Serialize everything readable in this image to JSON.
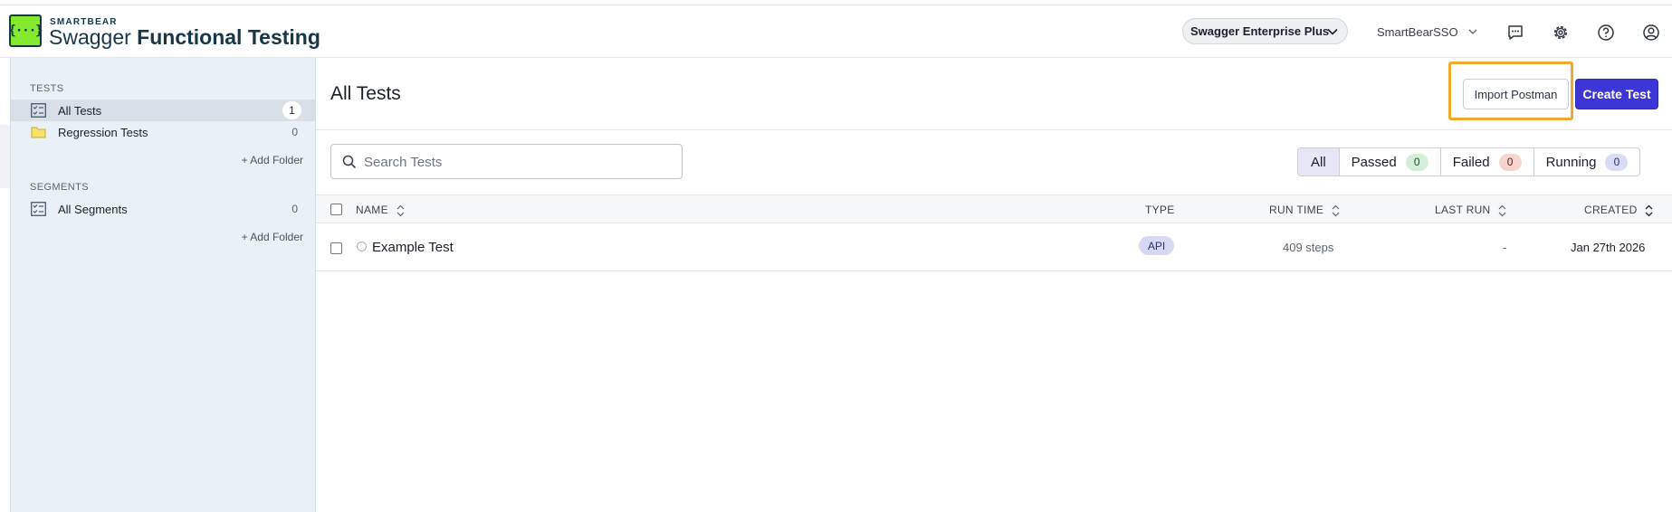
{
  "header": {
    "brand_small": "SMARTBEAR",
    "brand_first": "Swagger",
    "brand_rest": "Functional Testing",
    "logo_text": "{···}",
    "plan_label": "Swagger Enterprise Plus",
    "user_label": "SmartBearSSO"
  },
  "sidebar": {
    "tests_section": "TESTS",
    "tests_items": [
      {
        "label": "All Tests",
        "count": "1",
        "icon": "test-list-icon"
      },
      {
        "label": "Regression Tests",
        "count": "0",
        "icon": "folder-icon"
      }
    ],
    "add_folder_label": "+ Add Folder",
    "segments_section": "SEGMENTS",
    "segments_items": [
      {
        "label": "All Segments",
        "count": "0",
        "icon": "test-list-icon"
      }
    ]
  },
  "main": {
    "title": "All Tests",
    "import_label": "Import Postman",
    "create_label": "Create Test",
    "search_placeholder": "Search Tests",
    "filters": [
      {
        "label": "All"
      },
      {
        "label": "Passed",
        "count": "0"
      },
      {
        "label": "Failed",
        "count": "0"
      },
      {
        "label": "Running",
        "count": "0"
      }
    ],
    "columns": {
      "name": "NAME",
      "type": "TYPE",
      "run_time": "RUN TIME",
      "last_run": "LAST RUN",
      "created": "CREATED"
    },
    "rows": [
      {
        "name": "Example Test",
        "type": "API",
        "run_time": "409 steps",
        "last_run": "-",
        "created": "Jan 27th 2026"
      }
    ]
  },
  "colors": {
    "accent": "#3d36d6",
    "highlight": "#f0a92a",
    "logo_green": "#85ea2d",
    "brand_navy": "#173647"
  }
}
